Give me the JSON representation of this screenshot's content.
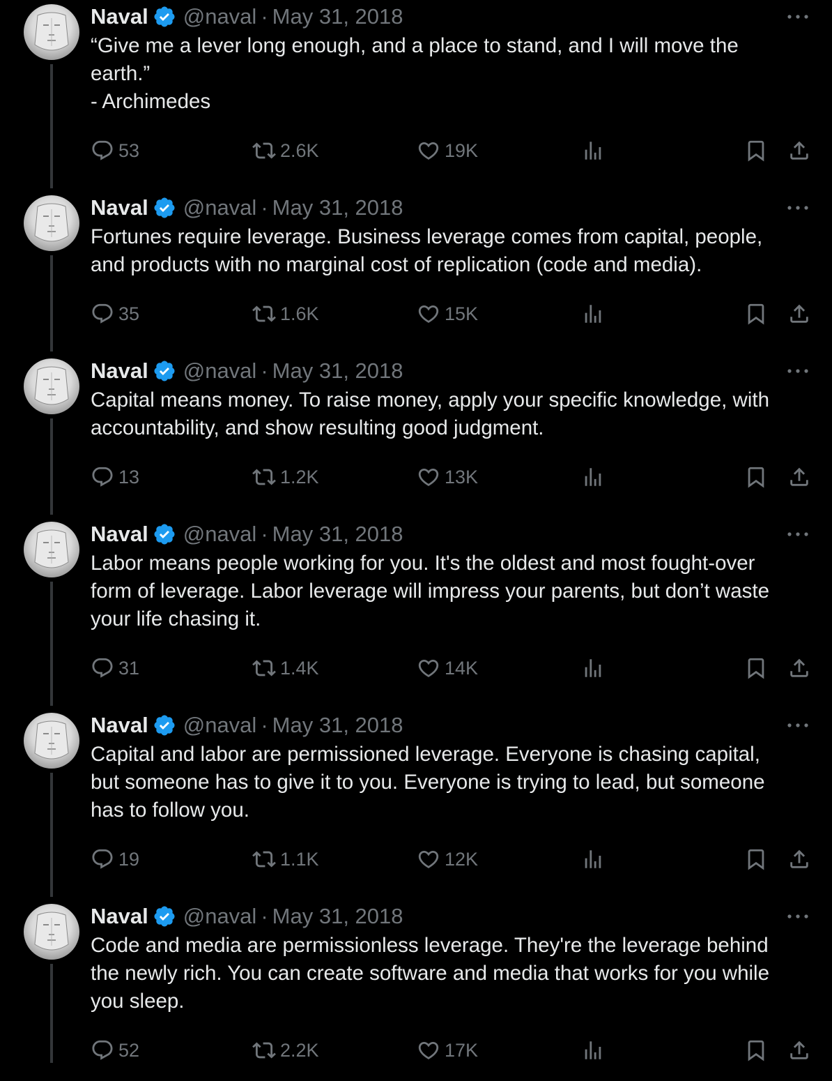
{
  "author": {
    "name": "Naval",
    "handle": "@naval",
    "separator": "·"
  },
  "icons": {
    "verified": "verified-badge-icon",
    "more": "more-icon",
    "reply": "reply-icon",
    "retweet": "retweet-icon",
    "like": "heart-icon",
    "views": "views-icon",
    "bookmark": "bookmark-icon",
    "share": "share-icon"
  },
  "colors": {
    "background": "#000000",
    "text": "#e7e9ea",
    "muted": "#71767b",
    "verified": "#1d9bf0",
    "thread_line": "#333639"
  },
  "tweets": [
    {
      "date": "May 31, 2018",
      "lines": [
        "“Give me a lever long enough, and a place to stand, and I will move the",
        "earth.”",
        "- Archimedes"
      ],
      "replies": "53",
      "retweets": "2.6K",
      "likes": "19K"
    },
    {
      "date": "May 31, 2018",
      "lines": [
        "Fortunes require leverage. Business leverage comes from capital, people,",
        "and products with no marginal cost of replication (code and media)."
      ],
      "replies": "35",
      "retweets": "1.6K",
      "likes": "15K"
    },
    {
      "date": "May 31, 2018",
      "lines": [
        "Capital means money. To raise money, apply your specific knowledge, with",
        "accountability, and show resulting good judgment."
      ],
      "replies": "13",
      "retweets": "1.2K",
      "likes": "13K"
    },
    {
      "date": "May 31, 2018",
      "lines": [
        "Labor means people working for you. It's the oldest and most fought-over",
        "form of leverage. Labor leverage will impress your parents, but don’t waste",
        "your life chasing it."
      ],
      "replies": "31",
      "retweets": "1.4K",
      "likes": "14K"
    },
    {
      "date": "May 31, 2018",
      "lines": [
        "Capital and labor are permissioned leverage. Everyone is chasing capital,",
        "but someone has to give it to you. Everyone is trying to lead, but someone",
        "has to follow you."
      ],
      "replies": "19",
      "retweets": "1.1K",
      "likes": "12K"
    },
    {
      "date": "May 31, 2018",
      "lines": [
        "Code and media are permissionless leverage. They're the leverage behind",
        "the newly rich. You can create software and media that works for you while",
        "you sleep."
      ],
      "replies": "52",
      "retweets": "2.2K",
      "likes": "17K"
    }
  ]
}
